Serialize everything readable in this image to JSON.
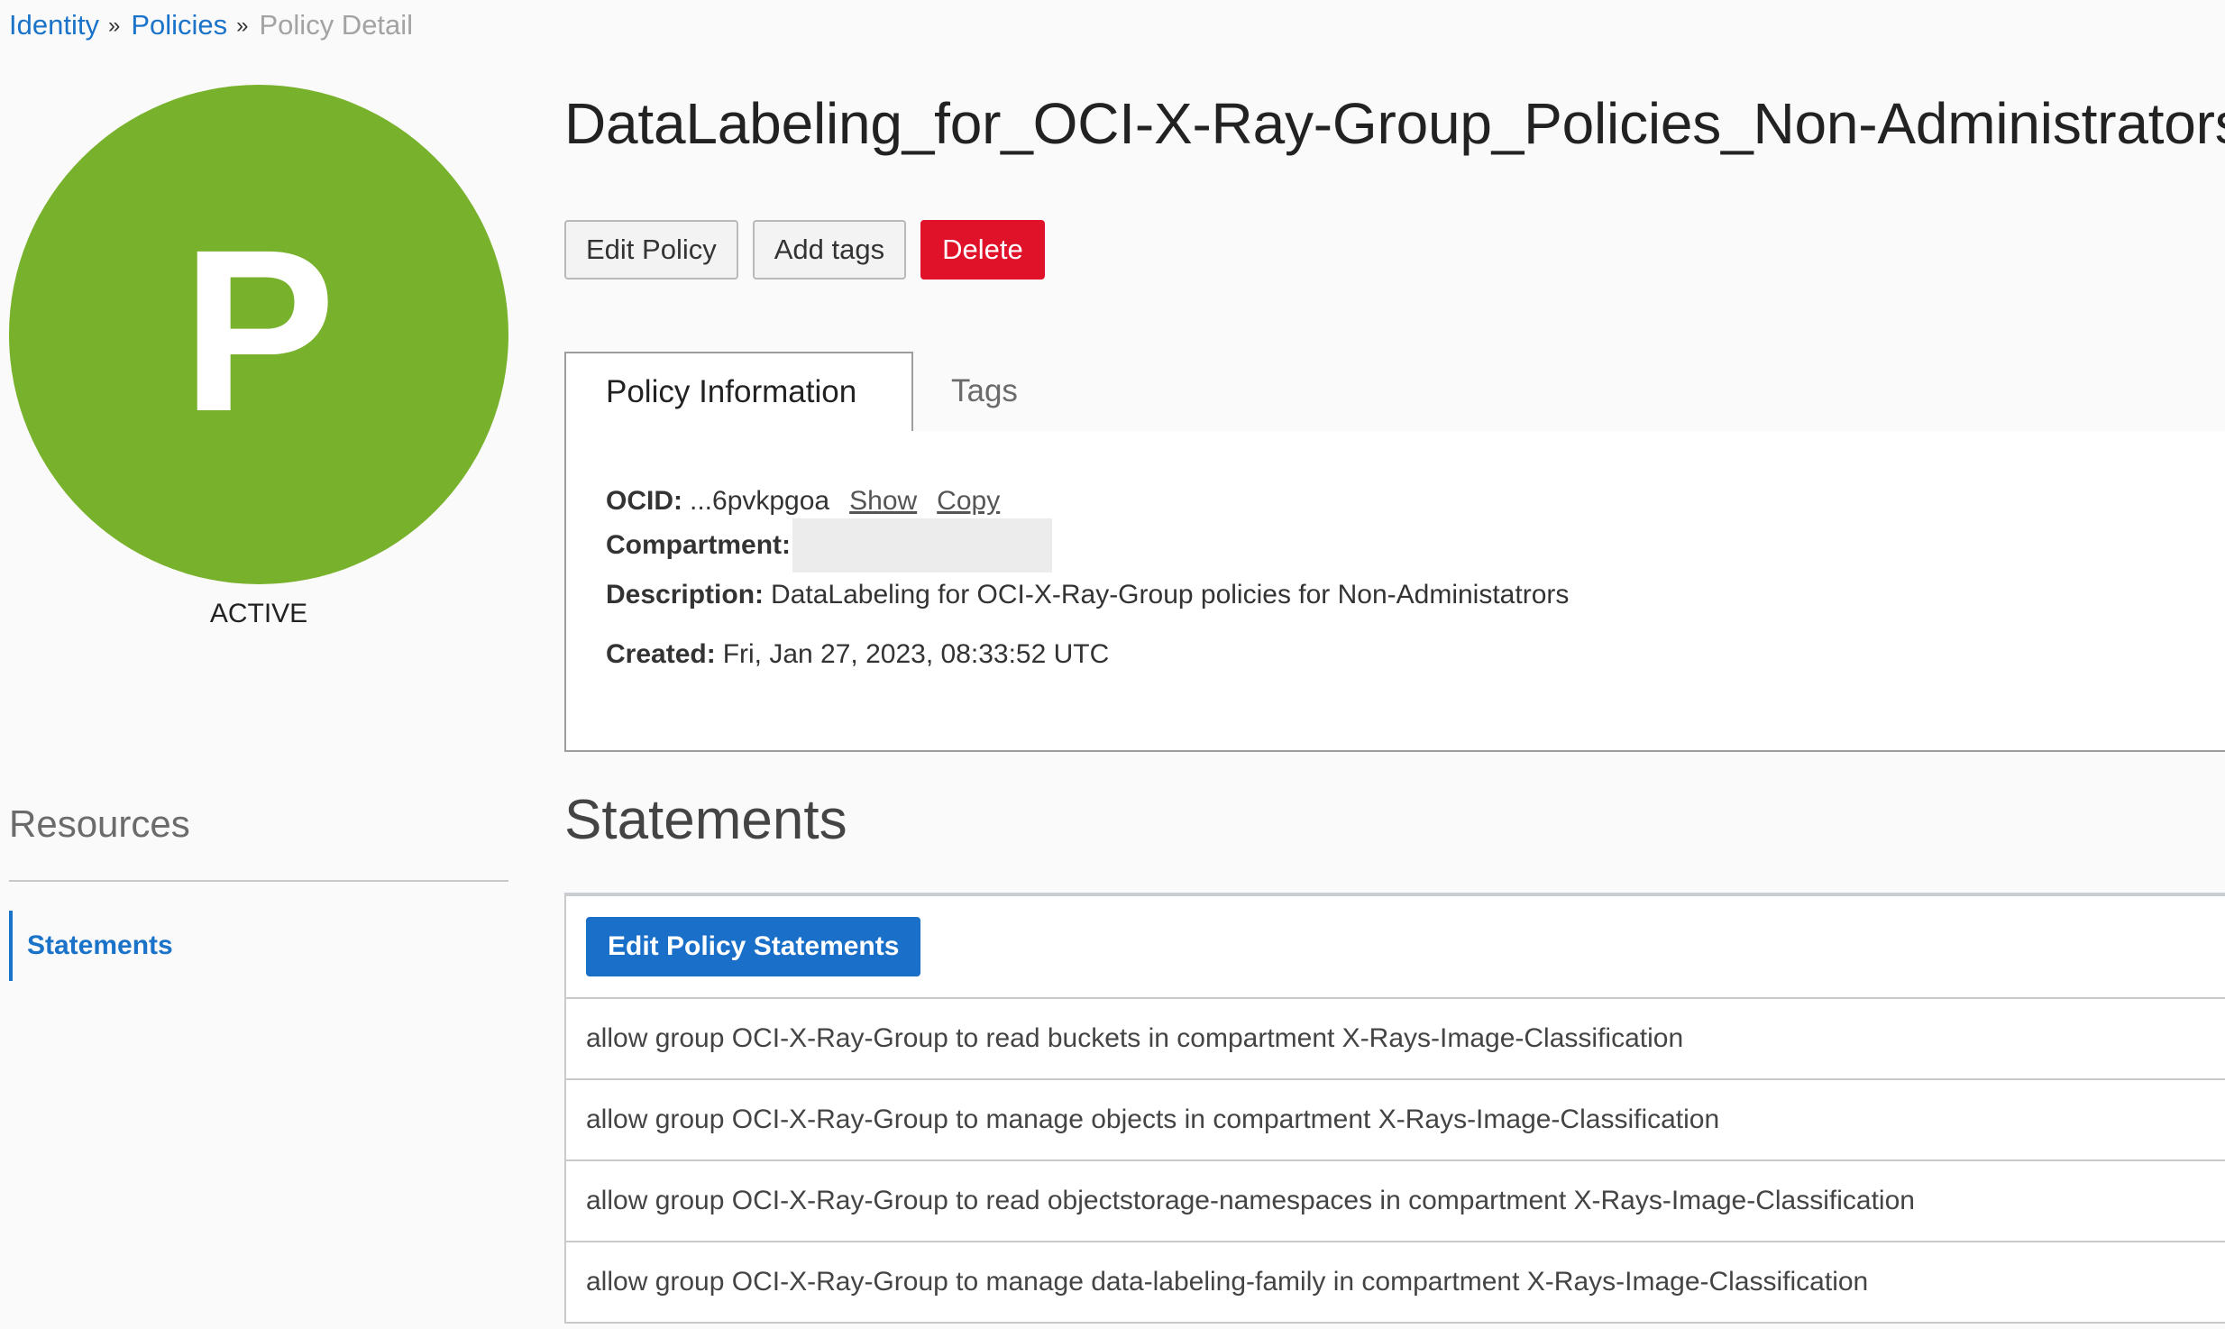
{
  "breadcrumb": {
    "items": [
      "Identity",
      "Policies"
    ],
    "separator": "»",
    "current": "Policy Detail"
  },
  "avatar": {
    "letter": "P",
    "color": "#78b22c",
    "status": "ACTIVE"
  },
  "resources": {
    "title": "Resources",
    "items": [
      "Statements"
    ]
  },
  "policy": {
    "title": "DataLabeling_for_OCI-X-Ray-Group_Policies_Non-Administrators"
  },
  "actions": {
    "edit": "Edit Policy",
    "add_tags": "Add tags",
    "delete": "Delete"
  },
  "tabs": [
    "Policy Information",
    "Tags"
  ],
  "info": {
    "ocid_label": "OCID:",
    "ocid_value": "...6pvkpgoa",
    "show_link": "Show",
    "copy_link": "Copy",
    "compartment_label": "Compartment:",
    "description_label": "Description:",
    "description_value": "DataLabeling for OCI-X-Ray-Group policies for Non-Administatrors",
    "created_label": "Created:",
    "created_value": "Fri, Jan 27, 2023, 08:33:52 UTC"
  },
  "statements": {
    "title": "Statements",
    "edit_button": "Edit Policy Statements",
    "rows": [
      "allow group OCI-X-Ray-Group to read buckets in compartment X-Rays-Image-Classification",
      "allow group OCI-X-Ray-Group to manage objects in compartment X-Rays-Image-Classification",
      "allow group OCI-X-Ray-Group to read objectstorage-namespaces in compartment X-Rays-Image-Classification",
      "allow group OCI-X-Ray-Group to manage data-labeling-family in compartment X-Rays-Image-Classification"
    ]
  },
  "colors": {
    "link": "#1a73c8",
    "danger": "#e0122a",
    "primary": "#1a6fc9",
    "avatar": "#78b22c"
  }
}
